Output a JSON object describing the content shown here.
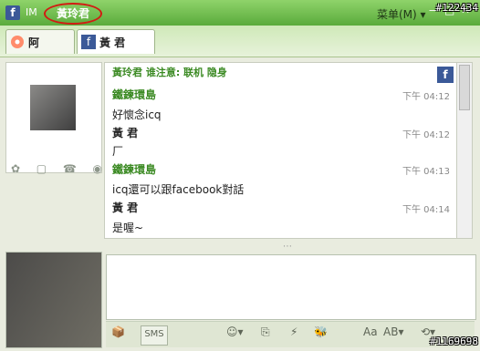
{
  "titlebar": {
    "app_logo": "f",
    "app_name": "IM",
    "contact": "黃玲君",
    "menu_label": "菜单(M)",
    "menu_arrow": "▾",
    "min_symbol": "—",
    "max_symbol": "□",
    "close_symbol": "✕",
    "corner_id": "#122434"
  },
  "tabs": [
    {
      "label": "阿",
      "icon": "flower-icon"
    },
    {
      "label": "黃 君",
      "icon": "facebook-icon"
    }
  ],
  "chat": {
    "header": "黃玲君 谁注意: 联机 隐身",
    "messages": [
      {
        "sender": "鐵鍊環島",
        "time": "下午 04:12",
        "text": "好懷念icq"
      },
      {
        "sender": "黃 君",
        "time": "下午 04:12",
        "text": "厂"
      },
      {
        "sender": "鐵鍊環島",
        "time": "下午 04:13",
        "text": "icq還可以跟facebook對話"
      },
      {
        "sender": "黃 君",
        "time": "下午 04:14",
        "text": "是喔~"
      }
    ]
  },
  "left": {
    "buttons": [
      "✿",
      "▢",
      "☎",
      "◉"
    ]
  },
  "input": {
    "placeholder": ""
  },
  "toolbar": {
    "sms_label": "SMS",
    "emoji_symbol": "☺▾",
    "file_symbol": "⎘",
    "bolt_symbol": "⚡",
    "bee_symbol": "🐝",
    "font_symbol": "Aa",
    "ab_symbol": "AB▾",
    "clock_symbol": "⟲▾"
  },
  "bottom_id": "#1169698"
}
